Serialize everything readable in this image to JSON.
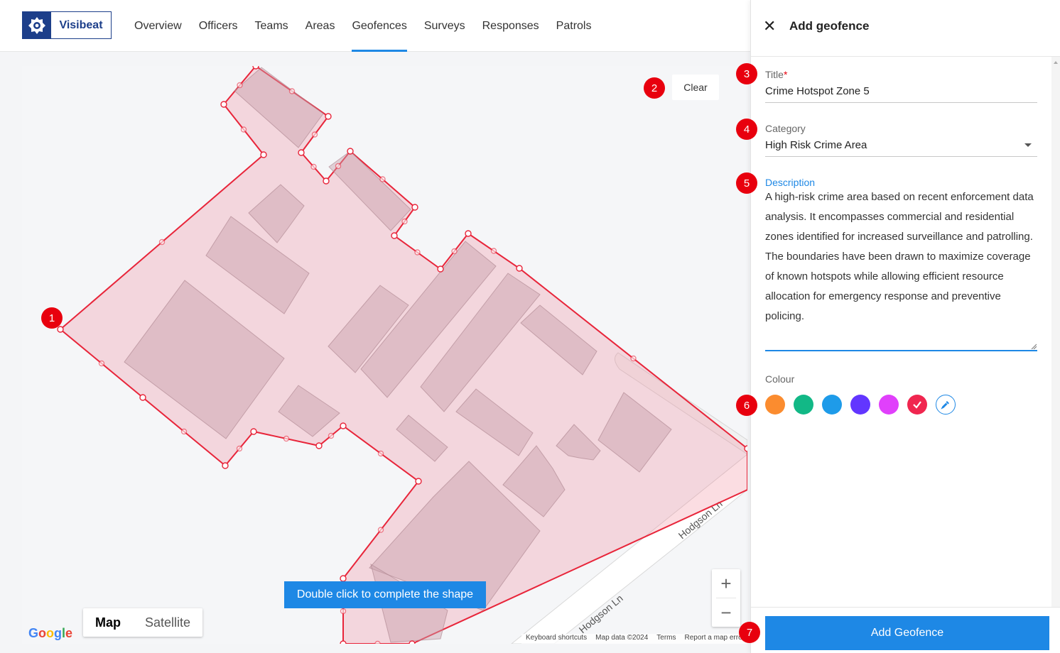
{
  "app": {
    "brand": "Visibeat",
    "nav": [
      "Overview",
      "Officers",
      "Teams",
      "Areas",
      "Geofences",
      "Surveys",
      "Responses",
      "Patrols"
    ],
    "active_nav": "Geofences"
  },
  "map": {
    "clear_label": "Clear",
    "hint": "Double click to complete the shape",
    "map_type": {
      "map": "Map",
      "satellite": "Satellite",
      "selected": "Map"
    },
    "zoom_in": "+",
    "zoom_out": "−",
    "road_label": "Hodgson Ln",
    "road_label_partial": "Hodgson Ln",
    "google_logo": "Google",
    "attribution": [
      "Keyboard shortcuts",
      "Map data ©2024",
      "Terms",
      "Report a map error"
    ],
    "polygon_color": "#e8253a",
    "polygon_fill": "#f7c6cd"
  },
  "markers": [
    "1",
    "2",
    "3",
    "4",
    "5",
    "6",
    "7"
  ],
  "panel": {
    "title": "Add geofence",
    "title_field": {
      "label": "Title",
      "required_mark": "*",
      "value": "Crime Hotspot Zone 5"
    },
    "category_field": {
      "label": "Category",
      "value": "High Risk Crime Area"
    },
    "description_field": {
      "label": "Description",
      "value": "A high-risk crime area based on recent enforcement data analysis. It encompasses commercial and residential zones identified for increased surveillance and patrolling. The boundaries have been drawn to maximize coverage of known hotspots while allowing efficient resource allocation for emergency response and preventive policing."
    },
    "colour_label": "Colour",
    "colours": [
      "#fb8c2f",
      "#12b886",
      "#1e9be9",
      "#6236ff",
      "#e040fb",
      "#f0264f"
    ],
    "selected_colour": "#f0264f",
    "submit_label": "Add Geofence"
  }
}
